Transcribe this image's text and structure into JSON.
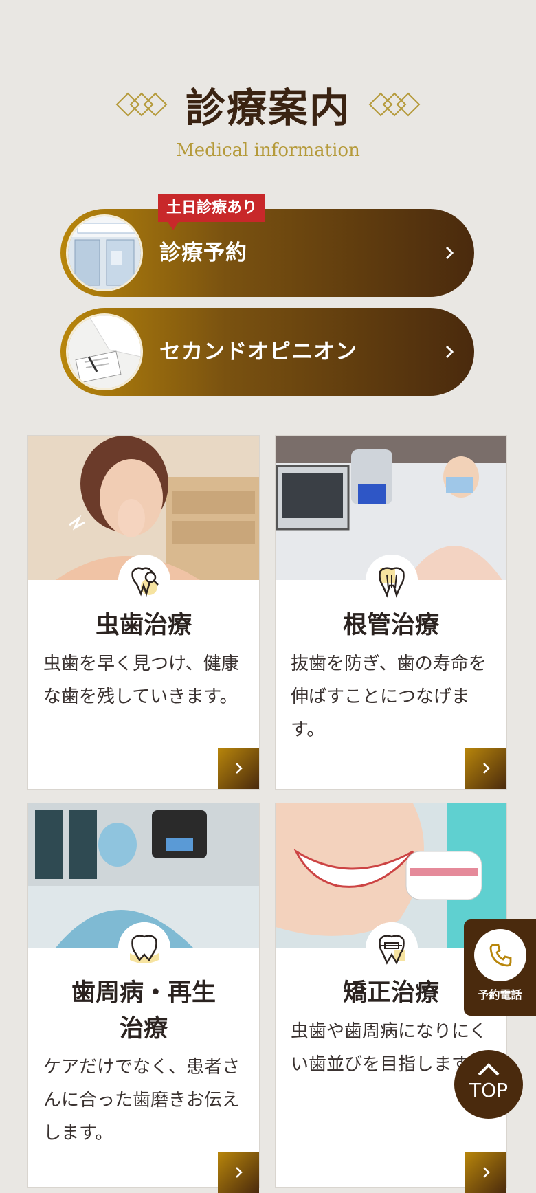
{
  "section": {
    "title": "診療案内",
    "subtitle": "Medical information"
  },
  "pills": [
    {
      "badge": "土日診療あり",
      "label": "診療予約"
    },
    {
      "label": "セカンドオピニオン"
    }
  ],
  "cards": [
    {
      "title": "虫歯治療",
      "desc": "虫歯を早く見つけ、健康な歯を残していきます。"
    },
    {
      "title": "根管治療",
      "desc": "抜歯を防ぎ、歯の寿命を伸ばすことにつなげます。"
    },
    {
      "title": "歯周病・再生治療",
      "desc": "ケアだけでなく、患者さんに合った歯磨きお伝えします。"
    },
    {
      "title": "矯正治療",
      "desc": "虫歯や歯周病になりにくい歯並びを目指します。"
    }
  ],
  "floating": {
    "tel_label": "予約電話",
    "top_label": "TOP"
  },
  "colors": {
    "background": "#e9e7e3",
    "gold": "#b8860b",
    "brown": "#4a2a0d",
    "badge_red": "#c8282a"
  }
}
